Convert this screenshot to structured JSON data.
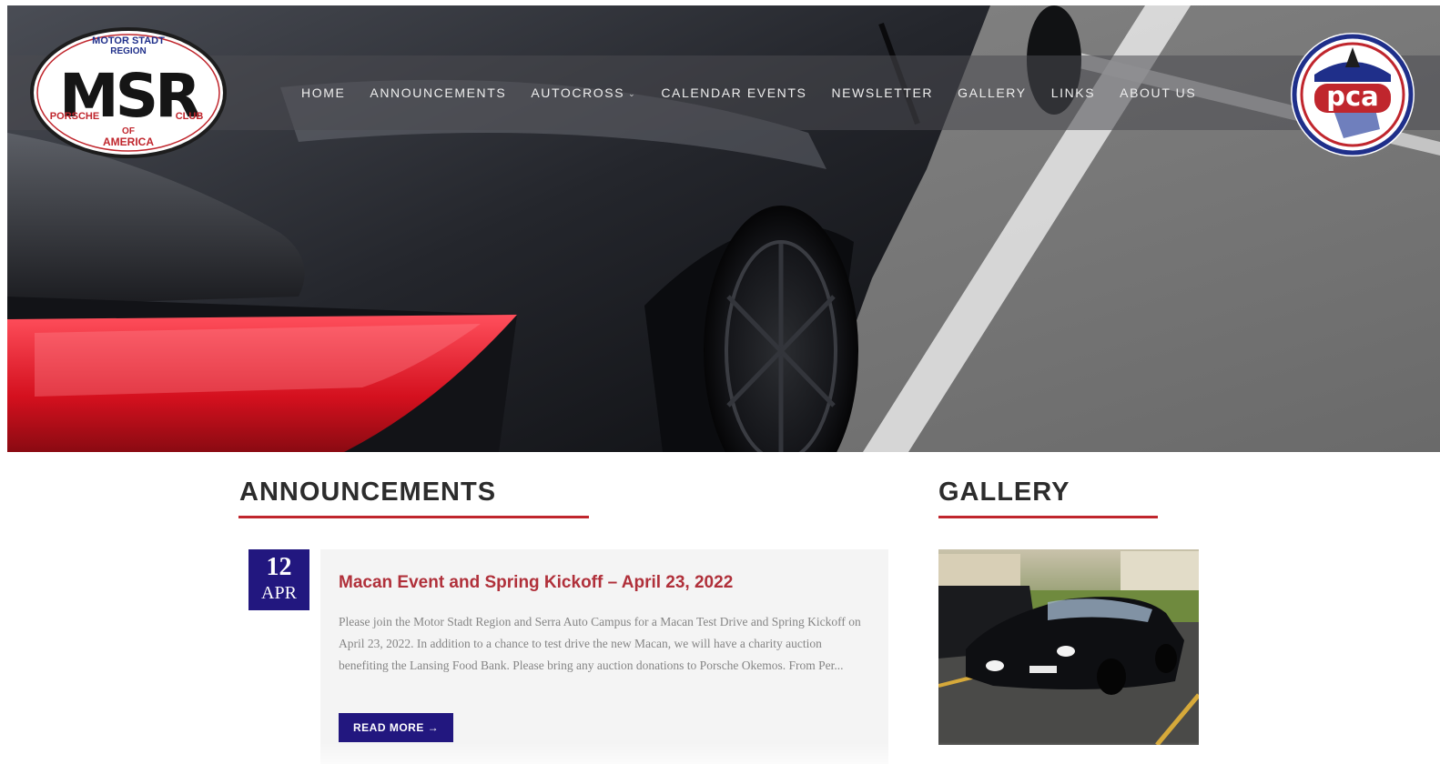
{
  "brand": {
    "msr_logo_top": "MOTOR STADT",
    "msr_logo_region": "REGION",
    "msr_logo_mark": "MSR",
    "msr_logo_left": "PORSCHE",
    "msr_logo_right": "CLUB",
    "msr_logo_of": "OF",
    "msr_logo_bottom": "AMERICA",
    "pca_logo_text": "pca"
  },
  "nav": {
    "items": [
      {
        "label": "HOME"
      },
      {
        "label": "ANNOUNCEMENTS"
      },
      {
        "label": "AUTOCROSS",
        "has_dropdown": true,
        "caret": "⌄"
      },
      {
        "label": "CALENDAR EVENTS"
      },
      {
        "label": "NEWSLETTER"
      },
      {
        "label": "GALLERY"
      },
      {
        "label": "LINKS"
      },
      {
        "label": "ABOUT US"
      }
    ]
  },
  "announcements": {
    "heading": "ANNOUNCEMENTS",
    "posts": [
      {
        "day": "12",
        "month": "APR",
        "title": "Macan Event and Spring Kickoff – April 23, 2022",
        "excerpt": "Please join the Motor Stadt Region and Serra Auto Campus for a Macan Test Drive and Spring Kickoff on April 23, 2022. In addition to a chance to test drive the new Macan, we will have a charity auction benefiting the Lansing Food Bank. Please bring any auction donations to Porsche Okemos. From Per...",
        "read_more": "READ MORE →"
      }
    ]
  },
  "gallery": {
    "heading": "GALLERY"
  },
  "colors": {
    "accent_red": "#c0262d",
    "brand_navy": "#22177f",
    "post_title": "#b0303a"
  }
}
